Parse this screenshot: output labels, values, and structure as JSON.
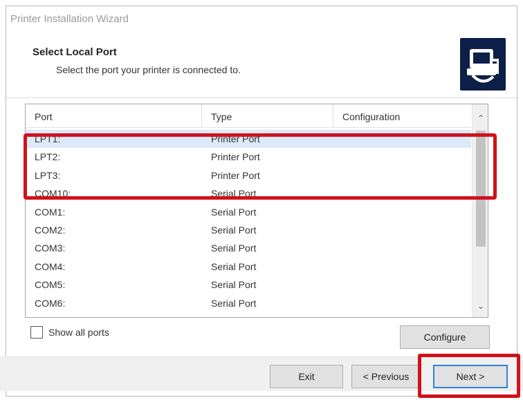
{
  "window": {
    "title": "Printer Installation Wizard"
  },
  "header": {
    "heading": "Select Local Port",
    "subheading": "Select the port your printer is connected to.",
    "logo_icon": "printer-wizard-icon"
  },
  "port_list": {
    "columns": [
      "Port",
      "Type",
      "Configuration"
    ],
    "rows": [
      {
        "port": "LPT1:",
        "type": "Printer Port",
        "config": ""
      },
      {
        "port": "LPT2:",
        "type": "Printer Port",
        "config": ""
      },
      {
        "port": "LPT3:",
        "type": "Printer Port",
        "config": ""
      },
      {
        "port": "COM10:",
        "type": "Serial Port",
        "config": ""
      },
      {
        "port": "COM1:",
        "type": "Serial Port",
        "config": ""
      },
      {
        "port": "COM2:",
        "type": "Serial Port",
        "config": ""
      },
      {
        "port": "COM3:",
        "type": "Serial Port",
        "config": ""
      },
      {
        "port": "COM4:",
        "type": "Serial Port",
        "config": ""
      },
      {
        "port": "COM5:",
        "type": "Serial Port",
        "config": ""
      },
      {
        "port": "COM6:",
        "type": "Serial Port",
        "config": ""
      }
    ],
    "selected_row": 0
  },
  "options": {
    "show_all_ports_label": "Show all ports",
    "show_all_ports_checked": false
  },
  "buttons": {
    "configure": "Configure",
    "exit": "Exit",
    "previous": "< Previous",
    "next": "Next >"
  },
  "colors": {
    "highlight_box": "#d0121b",
    "selected_row": "#dce9f8",
    "logo_bg": "#0c1f47",
    "default_button_border": "#2f7fd6"
  }
}
